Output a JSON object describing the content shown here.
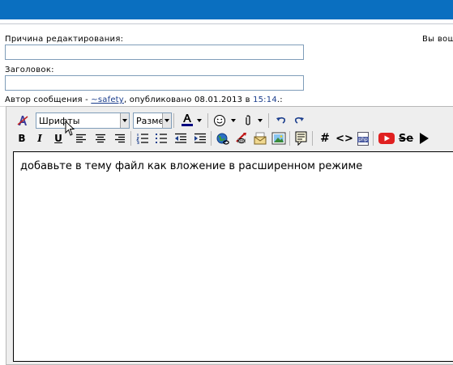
{
  "form": {
    "reason_label": "Причина редактирования:",
    "reason_value": "",
    "title_label": "Заголовок:",
    "title_value": "",
    "right_partial_text": "Вы вош",
    "author_prefix": "Автор сообщения - ",
    "author_name": "~safety",
    "author_mid": ", опубликовано 08.01.2013 в ",
    "author_time": "15:14",
    "author_suffix": ".:"
  },
  "toolbar": {
    "font_select": "Шрифты",
    "size_select": "Разме",
    "bold": "B",
    "italic": "I",
    "underline": "U",
    "hash": "#",
    "code": "<>",
    "php": "php",
    "strike": "Se"
  },
  "editor": {
    "content": "добавьте в тему файл как вложение в расширенном режиме"
  },
  "colors": {
    "topbar": "#0a6fc0",
    "link": "#1a3d8c",
    "youtube": "#e02020"
  }
}
